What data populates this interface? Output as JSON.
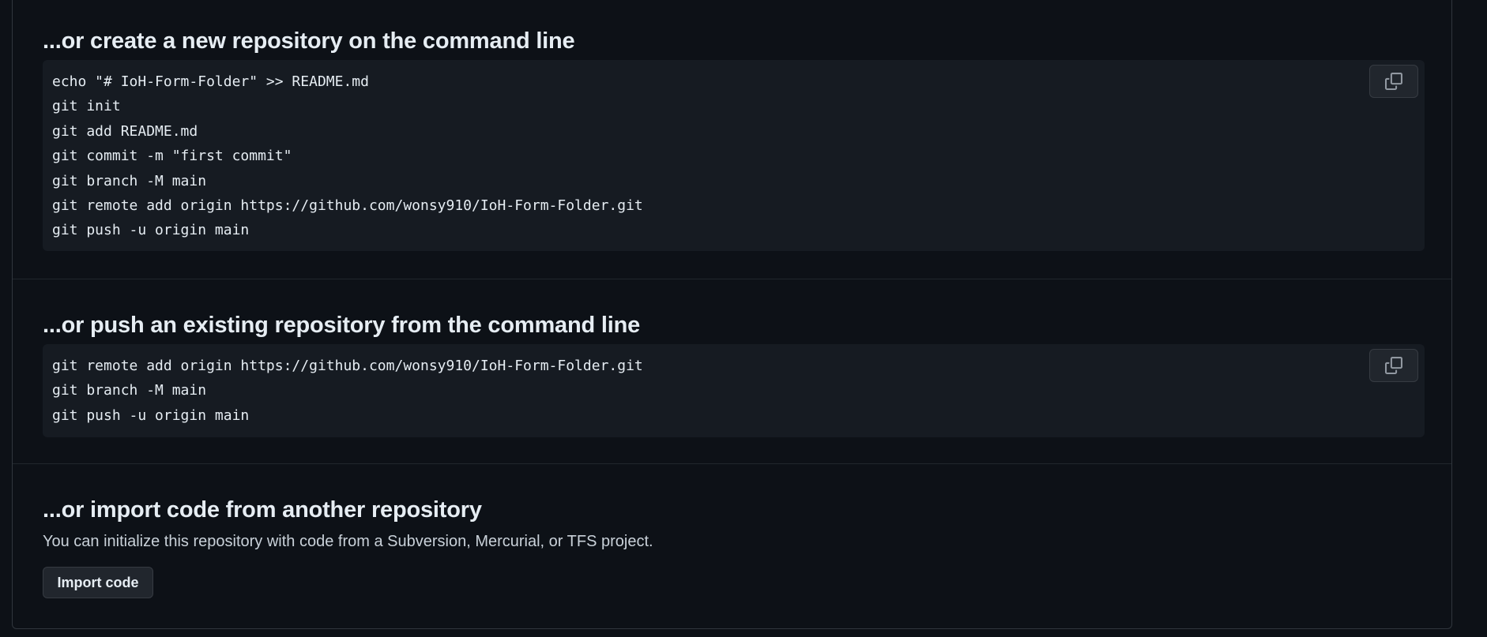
{
  "create_section": {
    "title": "...or create a new repository on the command line",
    "lines": [
      "echo \"# IoH-Form-Folder\" >> README.md",
      "git init",
      "git add README.md",
      "git commit -m \"first commit\"",
      "git branch -M main",
      "git remote add origin https://github.com/wonsy910/IoH-Form-Folder.git",
      "git push -u origin main"
    ],
    "copy_icon": "copy-icon"
  },
  "push_section": {
    "title": "...or push an existing repository from the command line",
    "lines": [
      "git remote add origin https://github.com/wonsy910/IoH-Form-Folder.git",
      "git branch -M main",
      "git push -u origin main"
    ],
    "copy_icon": "copy-icon"
  },
  "import_section": {
    "title": "...or import code from another repository",
    "description": "You can initialize this repository with code from a Subversion, Mercurial, or TFS project.",
    "button_label": "Import code"
  },
  "colors": {
    "background": "#0d1117",
    "code_background": "#161b22",
    "border": "#30363d",
    "button_background": "#21262d",
    "text": "#e6edf3",
    "muted_text": "#c9d1d9"
  }
}
